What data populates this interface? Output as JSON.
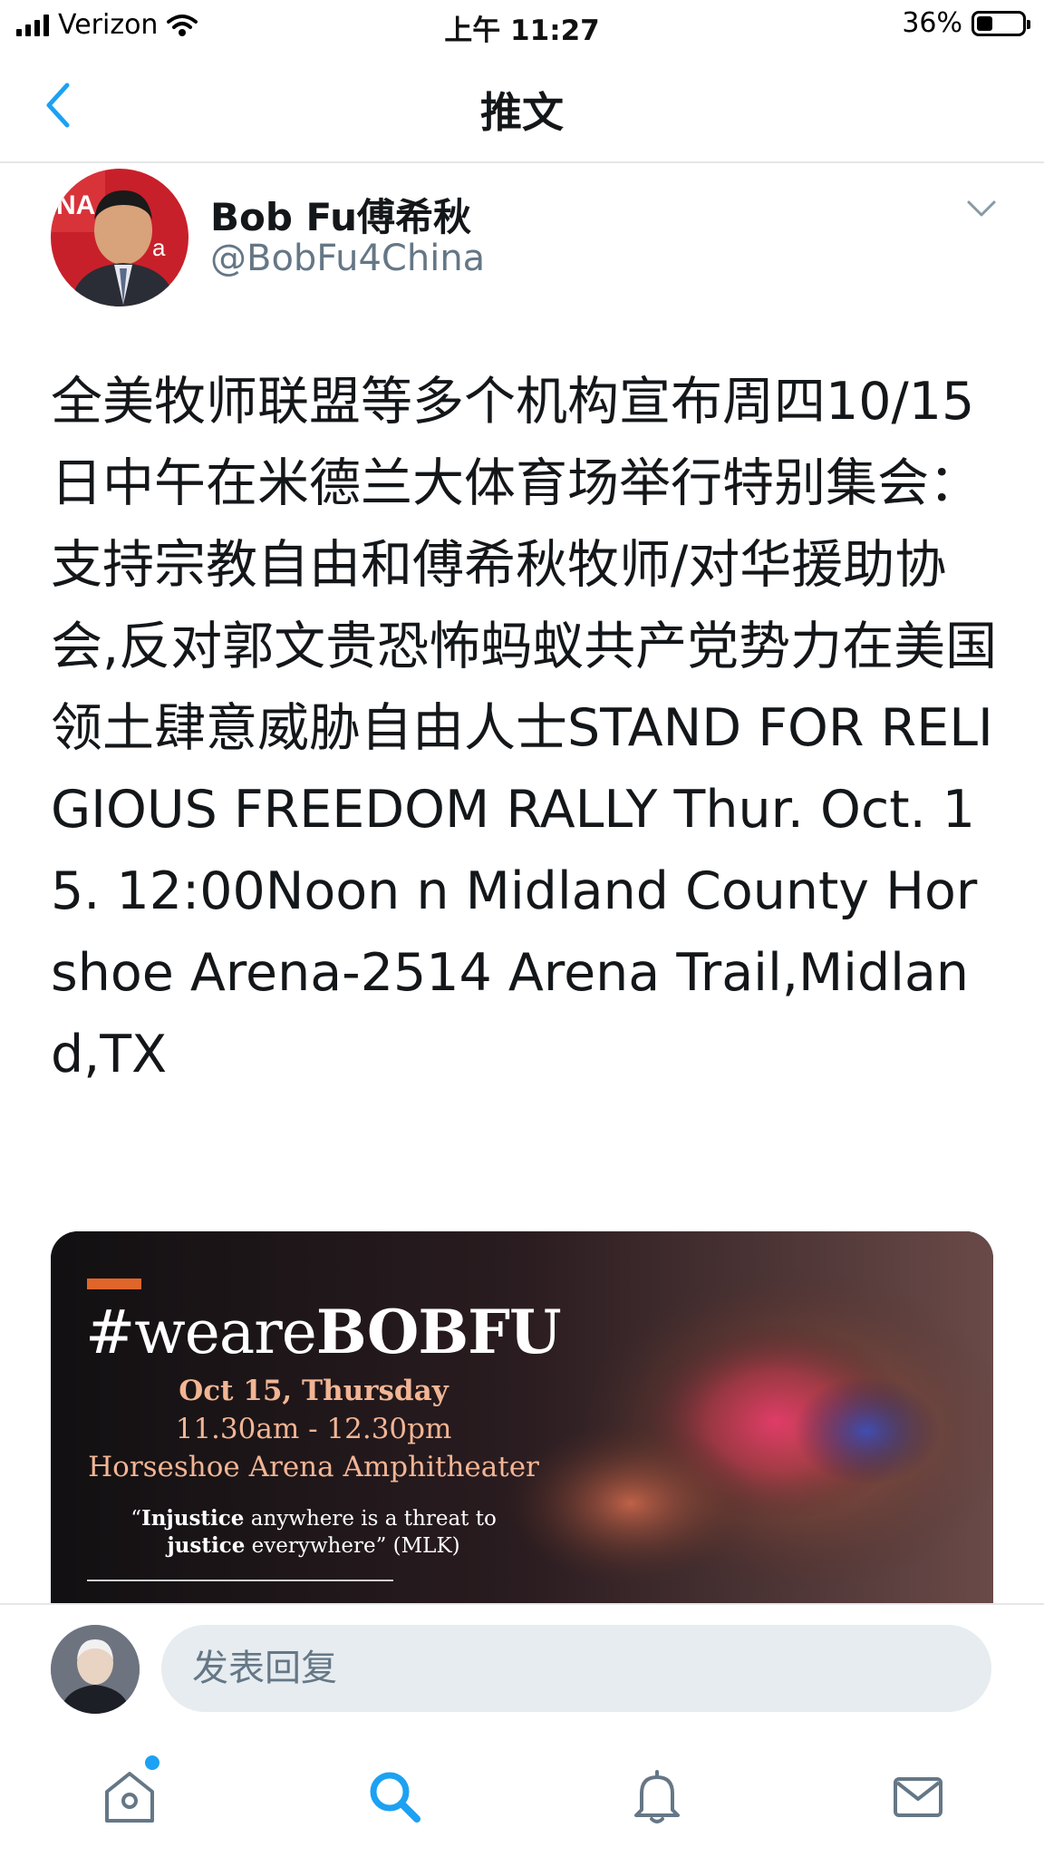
{
  "status_bar": {
    "carrier": "Verizon",
    "time": "上午 11:27",
    "battery_percent": "36%",
    "battery_level": 0.36
  },
  "nav": {
    "title": "推文",
    "back_icon": "chevron-left-icon"
  },
  "tweet": {
    "author_name": "Bob Fu傅希秋",
    "author_handle": "@BobFu4China",
    "text": "全美牧师联盟等多个机构宣布周四10/15日中午在米德兰大体育场举行特别集会：支持宗教自由和傅希秋牧师/对华援助协会,反对郭文贵恐怖蚂蚁共产党势力在美国领土肆意威胁自由人士STAND FOR RELIGIOUS FREEDOM RALLY Thur. Oct. 15. 12:00Noon n Midland County Horshoe Arena-2514 Arena Trail,Midland,TX",
    "media": {
      "hashtag_prefix": "#weare",
      "hashtag_bold": "BOBFU",
      "date": "Oct 15, Thursday",
      "time": "11.30am - 12.30pm",
      "venue": "Horseshoe Arena Amphitheater",
      "quote_line1_bold": "Injustice",
      "quote_line1_rest": " anywhere is a threat to",
      "quote_line2_bold": "justice",
      "quote_line2_rest": " everywhere” (MLK)",
      "quote_open": "“",
      "accent_color": "#e0652a"
    }
  },
  "reply": {
    "placeholder": "发表回复"
  },
  "tab_bar": {
    "items": [
      "home-icon",
      "search-icon",
      "notifications-icon",
      "messages-icon"
    ],
    "active": "search-icon",
    "active_color": "#1da1f2"
  }
}
